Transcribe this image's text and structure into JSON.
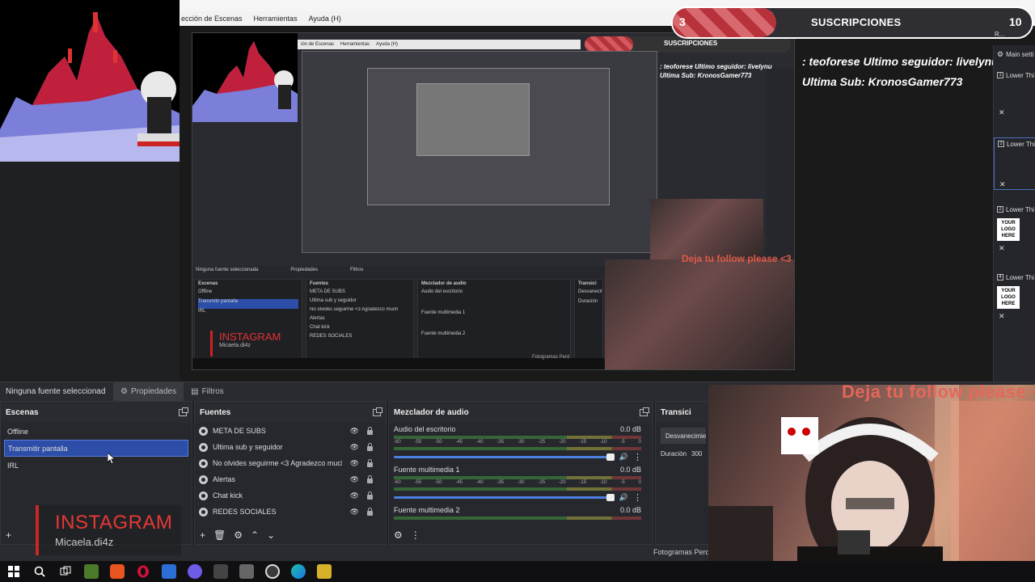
{
  "menubar": {
    "items": [
      "ección de Escenas",
      "Herramientas",
      "Ayuda (H)"
    ]
  },
  "subscriptions": {
    "current": "3",
    "label": "SUSCRIPCIONES",
    "goal": "10"
  },
  "follower_info": {
    "line1": ": teoforese   Ultimo seguidor: livelynu",
    "line2": "Ultima Sub: KronosGamer773"
  },
  "lower_thirds_dock": {
    "items": [
      {
        "num": "1",
        "label": "Lower Thi"
      },
      {
        "num": "3",
        "label": "Lower Thi"
      },
      {
        "num": "2",
        "label": "Lower Thi"
      },
      {
        "num": "4",
        "label": "Lower Thi"
      }
    ],
    "header": "Main setti",
    "logo_text": "YOUR LOGO HERE",
    "search_label": "R..."
  },
  "dockbar": {
    "no_source": "Ninguna fuente seleccionad",
    "properties": "Propiedades",
    "filters": "Filtros"
  },
  "scenes": {
    "title": "Escenas",
    "items": [
      "Offline",
      "Transmitir pantalla",
      "IRL"
    ]
  },
  "sources": {
    "title": "Fuentes",
    "items": [
      "META DE SUBS",
      "Ultima sub y seguidor",
      "No olvides seguirme <3 Agradezco much",
      "Alertas",
      "Chat kick",
      "REDES SOCIALES"
    ]
  },
  "mixer": {
    "title": "Mezclador de audio",
    "scale": [
      "-60",
      "-55",
      "-50",
      "-45",
      "-40",
      "-35",
      "-30",
      "-25",
      "-20",
      "-15",
      "-10",
      "-5",
      "0"
    ],
    "channels": [
      {
        "name": "Audio del escritorio",
        "db": "0.0 dB"
      },
      {
        "name": "Fuente multimedia 1",
        "db": "0.0 dB"
      },
      {
        "name": "Fuente multimedia 2",
        "db": "0.0 dB"
      }
    ]
  },
  "transitions": {
    "title": "Transici",
    "type": "Desvanecimie",
    "duration_label": "Duración",
    "duration_value": "300"
  },
  "status": {
    "fps_label": "Fotogramas Perd"
  },
  "instagram": {
    "title": "INSTAGRAM",
    "handle": "Micaela.di4z"
  },
  "follow_overlay": "Deja tu follow please <3",
  "nested": {
    "menu": [
      "ión de Escenas",
      "Herramientas",
      "Ayuda (H)"
    ],
    "subs": "SUSCRIPCIONES",
    "line1": ": teoforese   Ultimo seguidor: livelynu",
    "line2": "Ultima Sub: KronosGamer773",
    "follow": "Deja tu follow please <3",
    "no_source": "Ninguna fuente seleccionada",
    "properties": "Propiedades",
    "filters": "Filtros",
    "scenes_title": "Escenas",
    "scenes": [
      "Offline",
      "Transmitir pantalla",
      "IRL"
    ],
    "sources_title": "Fuentes",
    "sources": [
      "META DE SUBS",
      "Ultima sub y seguidor",
      "No olvides seguirme <3 Agradezco much",
      "Alertas",
      "Chat kick",
      "REDES SOCIALES"
    ],
    "mixer_title": "Mezclador de audio",
    "mixer": [
      "Audio del escritorio",
      "Fuente multimedia 1",
      "Fuente multimedia 2"
    ],
    "trans_title": "Transici",
    "trans_type": "Desvanecim",
    "duration": "Duración",
    "fps": "Fotogramas Perd",
    "insta_title": "INSTAGRAM",
    "insta_handle": "Micaela.di4z"
  },
  "taskbar": {
    "icons": [
      "windows-start-icon",
      "search-icon",
      "task-view-icon",
      "minecraft-icon",
      "brave-icon",
      "opera-icon",
      "app-icon",
      "discord-icon",
      "calculator-icon",
      "app2-icon",
      "obs-icon",
      "edge-icon",
      "streamlabs-icon"
    ]
  },
  "colors": {
    "accent_selection": "#2d4ea8",
    "instagram_red": "#e53935",
    "follow_text": "#e4675a",
    "subbar_stripe": "#b8323c"
  }
}
